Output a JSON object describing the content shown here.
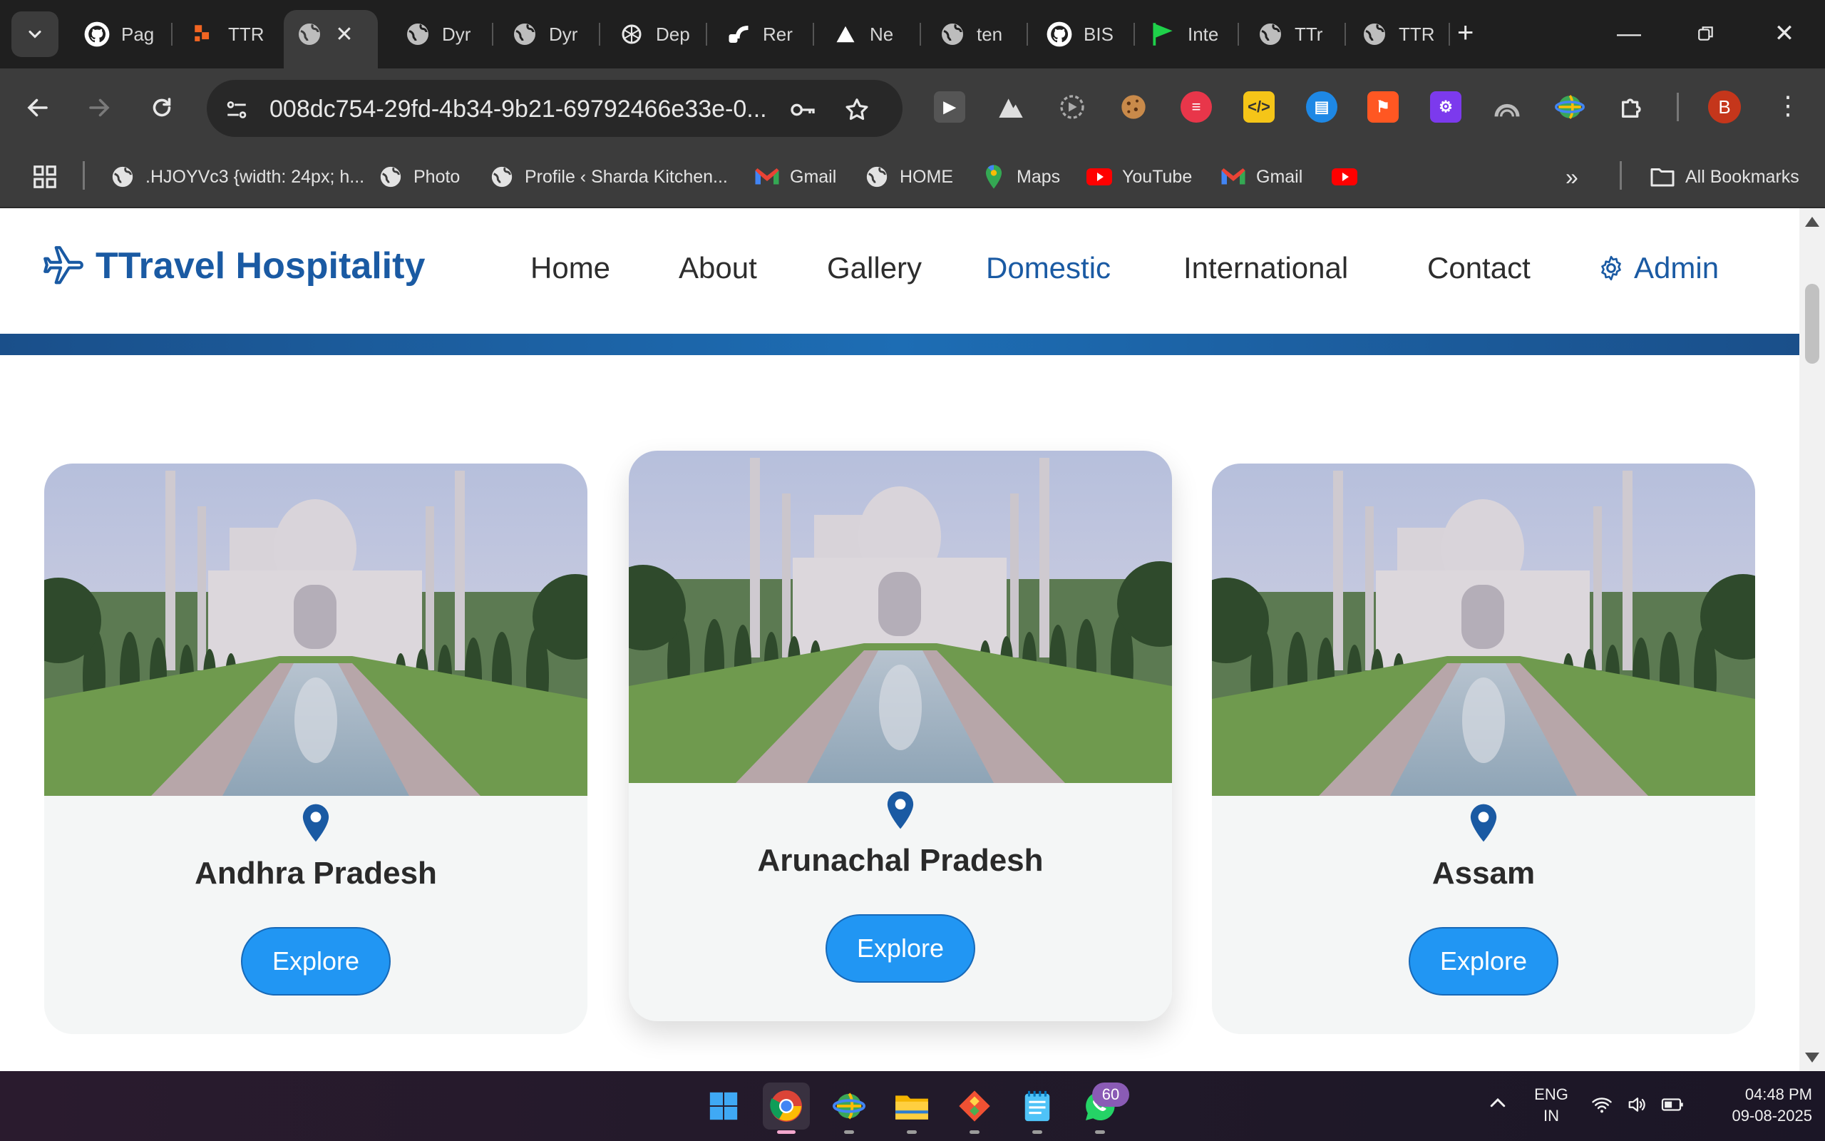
{
  "browser": {
    "tabs": [
      {
        "title": "Pag",
        "icon": "github-icon"
      },
      {
        "title": "TTR",
        "icon": "orange-blocks-icon"
      },
      {
        "title": "",
        "icon": "globe-icon",
        "active": true
      },
      {
        "title": "Dyr",
        "icon": "globe-icon"
      },
      {
        "title": "Dyr",
        "icon": "globe-icon"
      },
      {
        "title": "Dep",
        "icon": "openai-icon"
      },
      {
        "title": "Rer",
        "icon": "render-icon"
      },
      {
        "title": "Ne",
        "icon": "triangle-icon"
      },
      {
        "title": "ten",
        "icon": "globe-icon"
      },
      {
        "title": "BIS",
        "icon": "github-icon"
      },
      {
        "title": "Inte",
        "icon": "flag-icon"
      },
      {
        "title": "TTr",
        "icon": "globe-icon"
      },
      {
        "title": "TTR",
        "icon": "globe-icon"
      }
    ],
    "url": "008dc754-29fd-4b34-9b21-69792466e33e-0...",
    "profile_initial": "B",
    "bookmarks": [
      {
        "label": ".HJOYVc3 {width: 24px; h...",
        "icon": "globe-icon"
      },
      {
        "label": "Photo",
        "icon": "globe-icon"
      },
      {
        "label": "Profile ‹ Sharda Kitchen...",
        "icon": "globe-icon"
      },
      {
        "label": "Gmail",
        "icon": "gmail-icon"
      },
      {
        "label": "HOME",
        "icon": "globe-icon"
      },
      {
        "label": "Maps",
        "icon": "maps-icon"
      },
      {
        "label": "YouTube",
        "icon": "youtube-icon"
      },
      {
        "label": "Gmail",
        "icon": "gmail-icon"
      },
      {
        "label": "",
        "icon": "youtube-icon"
      }
    ],
    "all_bookmarks": "All Bookmarks"
  },
  "site": {
    "brand": "TTravel Hospitality",
    "nav": {
      "home": "Home",
      "about": "About",
      "gallery": "Gallery",
      "domestic": "Domestic",
      "international": "International",
      "contact": "Contact",
      "admin": "Admin"
    },
    "active_nav": "Domestic",
    "accent_color": "#1a5aa3",
    "button_color": "#2196f3",
    "cards": [
      {
        "name": "Andhra Pradesh",
        "button": "Explore",
        "image": "Taj Mahal photo"
      },
      {
        "name": "Arunachal Pradesh",
        "button": "Explore",
        "image": "Taj Mahal photo"
      },
      {
        "name": "Assam",
        "button": "Explore",
        "image": "Taj Mahal photo"
      }
    ]
  },
  "taskbar": {
    "apps": [
      "windows-start-icon",
      "chrome-icon",
      "bookmark-manager-icon",
      "file-explorer-icon",
      "git-icon",
      "notepad-icon",
      "whatsapp-icon"
    ],
    "whatsapp_badge": "60",
    "language_line1": "ENG",
    "language_line2": "IN",
    "time": "04:48 PM",
    "date": "09-08-2025"
  }
}
